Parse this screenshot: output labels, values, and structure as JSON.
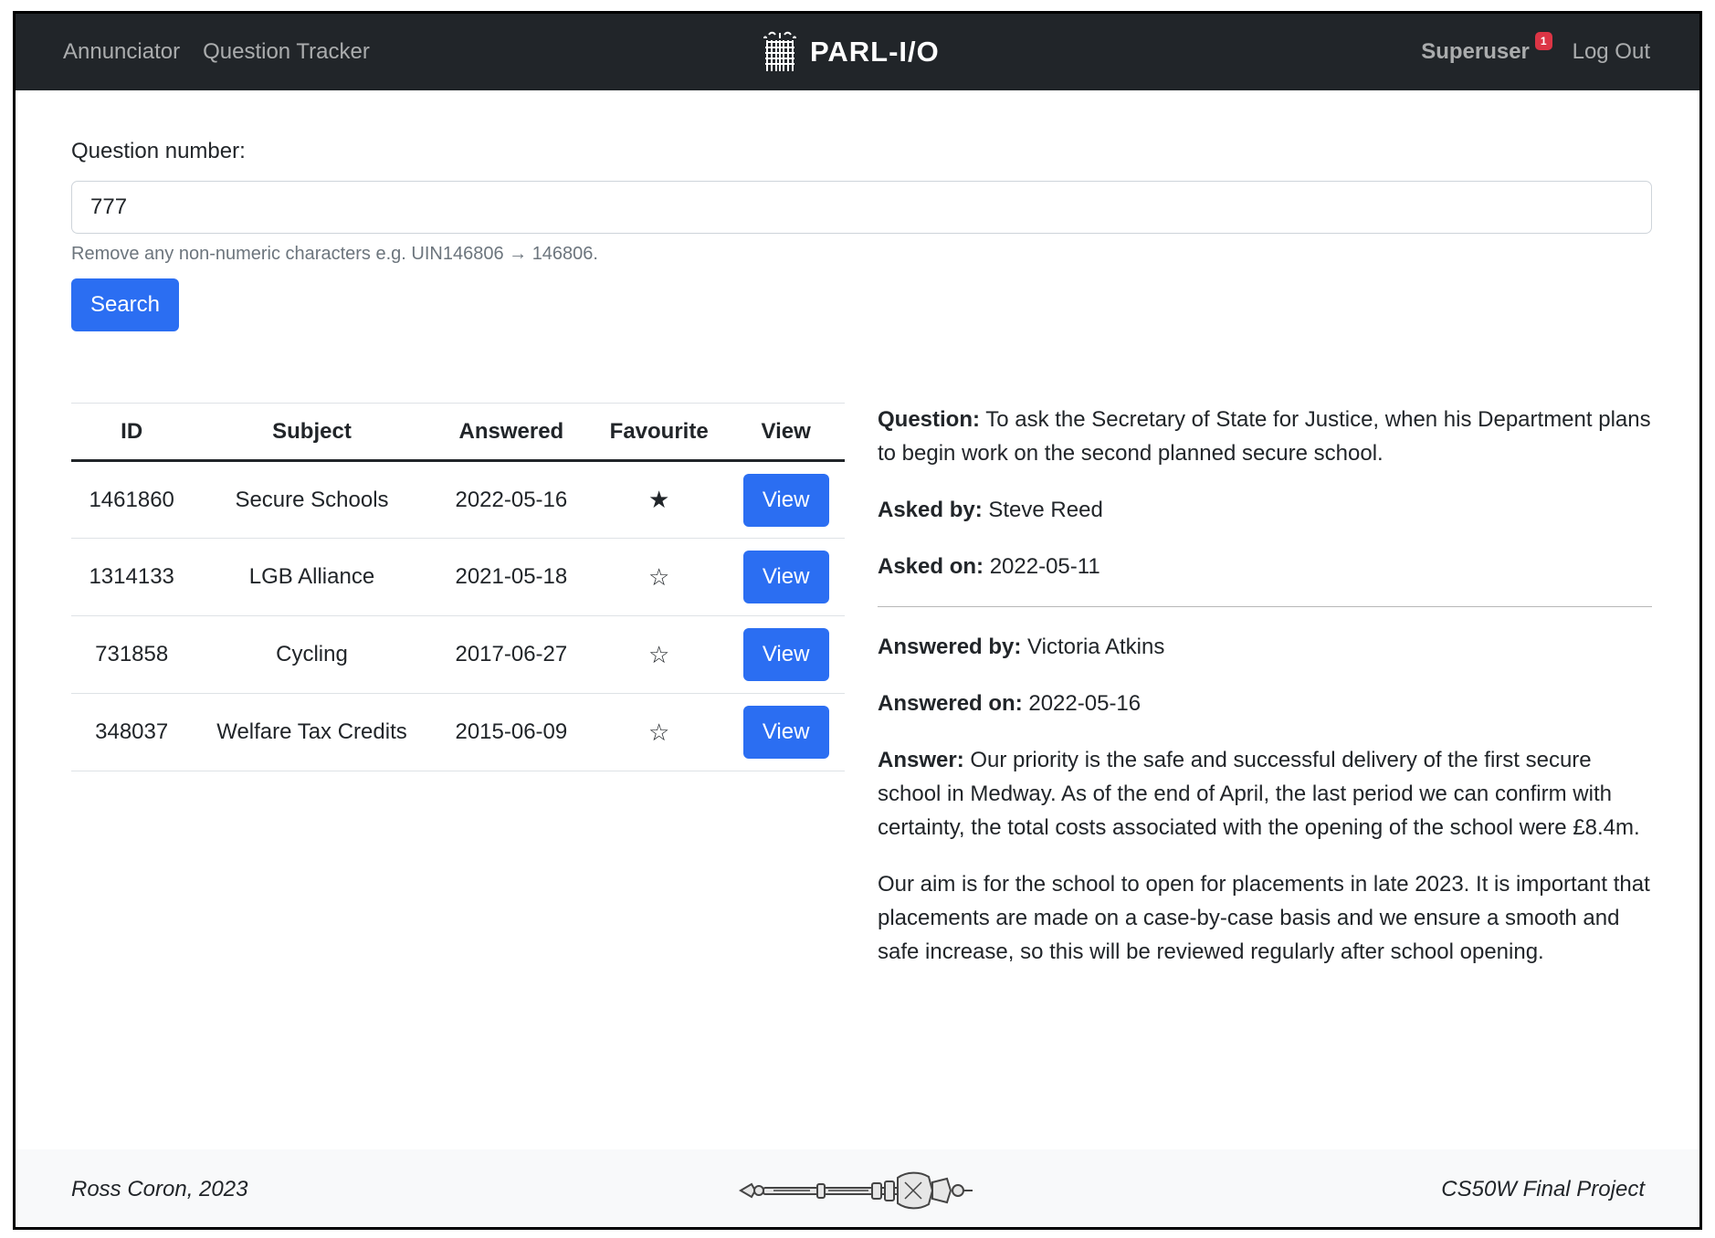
{
  "nav": {
    "links": [
      "Annunciator",
      "Question Tracker"
    ],
    "brand": "PARL-I/O",
    "user": "Superuser",
    "notifications": "1",
    "logout": "Log Out"
  },
  "search": {
    "label": "Question number:",
    "value": "777",
    "help": "Remove any non-numeric characters e.g. UIN146806 → 146806.",
    "button": "Search"
  },
  "table": {
    "headers": [
      "ID",
      "Subject",
      "Answered",
      "Favourite",
      "View"
    ],
    "rows": [
      {
        "id": "1461860",
        "subject": "Secure Schools",
        "answered": "2022-05-16",
        "favourite": "★",
        "view": "View"
      },
      {
        "id": "1314133",
        "subject": "LGB Alliance",
        "answered": "2021-05-18",
        "favourite": "☆",
        "view": "View"
      },
      {
        "id": "731858",
        "subject": "Cycling",
        "answered": "2017-06-27",
        "favourite": "☆",
        "view": "View"
      },
      {
        "id": "348037",
        "subject": "Welfare Tax Credits",
        "answered": "2015-06-09",
        "favourite": "☆",
        "view": "View"
      }
    ]
  },
  "detail": {
    "question_label": "Question:",
    "question": "To ask the Secretary of State for Justice, when his Department plans to begin work on the second planned secure school.",
    "asked_by_label": "Asked by:",
    "asked_by": "Steve Reed",
    "asked_on_label": "Asked on:",
    "asked_on": "2022-05-11",
    "answered_by_label": "Answered by:",
    "answered_by": "Victoria Atkins",
    "answered_on_label": "Answered on:",
    "answered_on": "2022-05-16",
    "answer_label": "Answer:",
    "answer_p1": "Our priority is the safe and successful delivery of the first secure school in Medway. As of the end of April, the last period we can confirm with certainty, the total costs associated with the opening of the school were £8.4m.",
    "answer_p2": "Our aim is for the school to open for placements in late 2023. It is important that placements are made on a case-by-case basis and we ensure a smooth and safe increase, so this will be reviewed regularly after school opening."
  },
  "footer": {
    "left": "Ross Coron, 2023",
    "right": "CS50W Final Project"
  }
}
